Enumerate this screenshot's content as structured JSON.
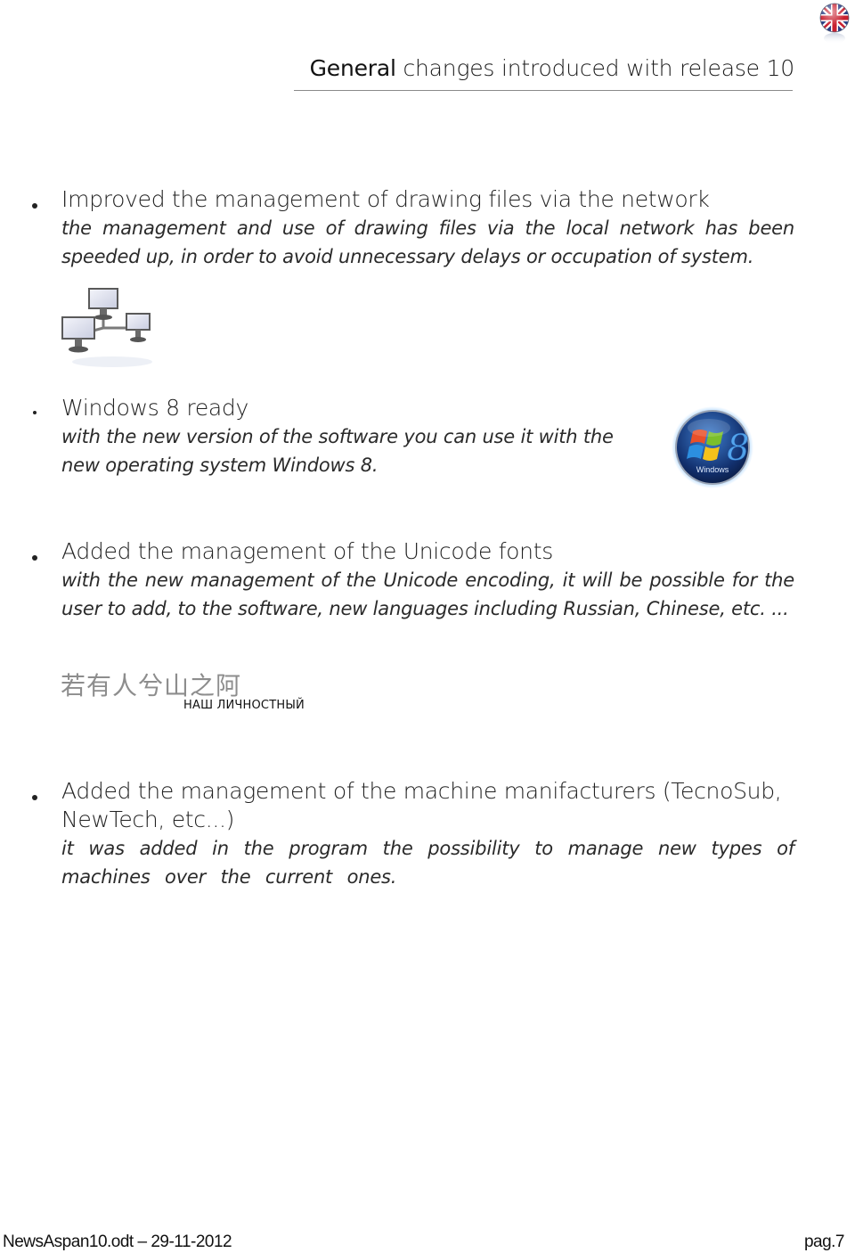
{
  "header": {
    "title_strong": "General",
    "title_rest": " changes introduced with release 10",
    "language_flag": "uk-flag-icon"
  },
  "sections": [
    {
      "heading": "Improved the management of drawing files via the network",
      "description": "the management and use of drawing files via the local network has been speeded up, in order to avoid unnecessary delays or occupation of system.",
      "image": "network-computers-illustration"
    },
    {
      "heading": "Windows 8 ready",
      "description": "with the new version of the software you can use it with the new operating system Windows 8.",
      "image": "windows-8-logo",
      "image_label": "Windows"
    },
    {
      "heading": "Added the management of the Unicode fonts",
      "description": "with the new management of the Unicode encoding, it will be possible for the user to add, to the software, new languages including Russian, Chinese, etc. ...",
      "image": "unicode-text-sample",
      "sample_chinese": "若有人兮山之阿",
      "sample_russian": "НАШ ЛИЧНОСТНЫЙ"
    },
    {
      "heading": "Added the management of the machine manifacturers (TecnoSub, NewTech, etc...)",
      "description": "it was added in the program the possibility to manage new types of machines over the current ones."
    }
  ],
  "footer": {
    "document": "NewsAspan10.odt – 29-11-2012",
    "page": "pag.7"
  }
}
